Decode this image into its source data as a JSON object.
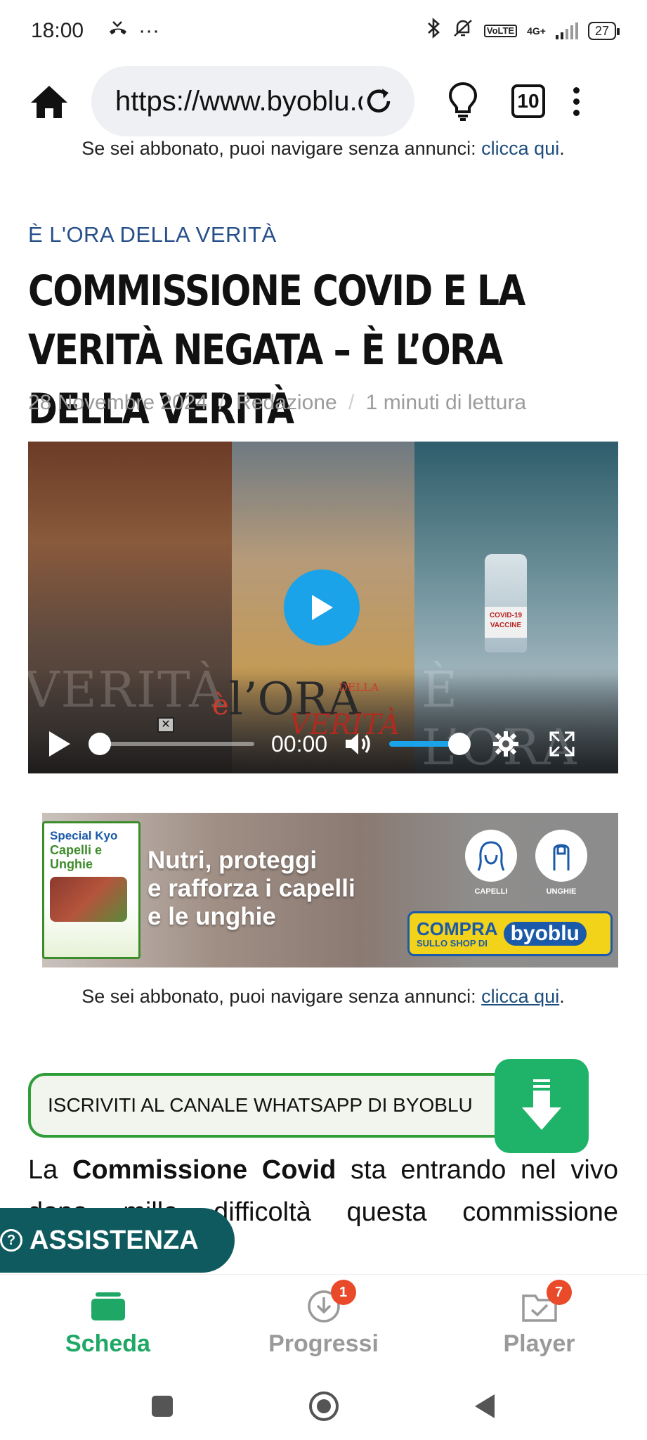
{
  "status_bar": {
    "time": "18:00",
    "notifications_more": "···",
    "battery": "27",
    "network": "4G+",
    "volte": "Vo LTE",
    "icons": [
      "missed-call-icon",
      "bluetooth-icon",
      "muted-bell-icon",
      "signal-icon",
      "battery-icon"
    ]
  },
  "browser": {
    "url": "https://www.byoblu.com",
    "tab_count": "10"
  },
  "page": {
    "subscriber_note": "Se sei abbonato, puoi navigare senza annunci: ",
    "subscriber_link": "clicca qui",
    "subscriber_end": ".",
    "kicker": "È L'ORA DELLA VERITÀ",
    "headline": "COMMISSIONE COVID E LA VERITÀ NEGATA – È L’ORA DELLA VERITÀ",
    "meta": {
      "date": "28 Novembre 2024",
      "author": "Redazione",
      "read_time": "1 minuti di lettura",
      "separator": "/"
    },
    "video": {
      "time": "00:00",
      "watermark_left": "VERITÀ",
      "watermark_right": "È L’ORA",
      "logo_e": "è",
      "logo_text": "l’ORA",
      "logo_della": "DELLA",
      "logo_verita": "VERITÀ",
      "vial_label": "COVID-19 VACCINE",
      "volume_level": 1.0,
      "progress": 0.0
    },
    "ad": {
      "brand": "Special Kyo",
      "product": "Capelli e Unghie",
      "headline_1": "Nutri, proteggi",
      "headline_2": "e rafforza i capelli",
      "headline_3": "e le unghie",
      "icon_1_label": "CAPELLI",
      "icon_2_label": "UNGHIE",
      "cta_1": "COMPRA",
      "cta_2": "SULLO SHOP DI",
      "cta_logo": "byoblu"
    },
    "whatsapp_button": "ISCRIVITI AL CANALE WHATSAPP DI BYOBLU",
    "body_text_1": "La ",
    "body_text_bold": "Commissione Covid",
    "body_text_2": " sta entrando nel vivo dopo mille difficoltà questa commissione parlamentare d’inchiesta",
    "assistance_button": "ASSISTENZA"
  },
  "app_nav": {
    "items": [
      {
        "label": "Scheda",
        "active": true,
        "badge": ""
      },
      {
        "label": "Progressi",
        "active": false,
        "badge": "1"
      },
      {
        "label": "Player",
        "active": false,
        "badge": "7"
      }
    ],
    "active_color": "#1fa865",
    "badge_color": "#e84a2a"
  }
}
